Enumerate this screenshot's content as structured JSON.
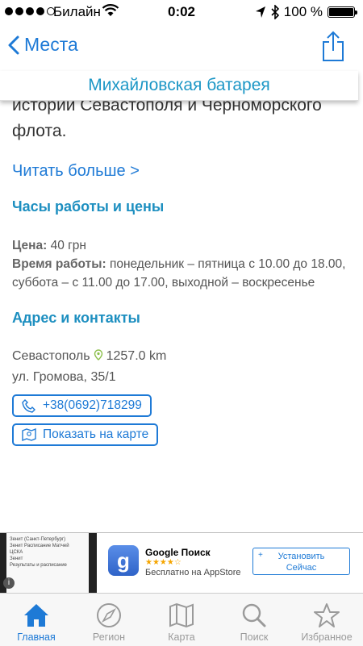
{
  "status_bar": {
    "carrier": "Билайн",
    "time": "0:02",
    "battery_text": "100 %",
    "battery_level": 1.0,
    "signal_bars_filled": 4
  },
  "nav": {
    "back_label": "Места",
    "title": "Михайловская батарея"
  },
  "content": {
    "intro": "истории Севастополя и Черноморского флота.",
    "read_more": "Читать больше >",
    "hours_section": {
      "heading": "Часы работы и цены",
      "price_label": "Цена:",
      "price_value": "40 грн",
      "hours_label": "Время работы:",
      "hours_value": "понедельник – пятница с 10.00 до 18.00, суббота – с 11.00 до 17.00, выходной – воскресенье"
    },
    "address_section": {
      "heading": "Адрес и контакты",
      "city": "Севастополь",
      "distance": "1257.0 km",
      "street": "ул. Громова, 35/1",
      "phone": "+38(0692)718299",
      "map_button": "Показать на карте"
    }
  },
  "ad": {
    "thumb_lines": [
      "Зенит (Санкт-Петербург)",
      "Зенит Расписание Матчей",
      "ЦСКА",
      "Зенит",
      "Результаты и расписание"
    ],
    "app_name": "Google Поиск",
    "stars": "★★★★☆",
    "subtitle": "Бесплатно на AppStore",
    "install_line1": "Установить",
    "install_line2": "Сейчас",
    "plus": "+",
    "icon_letter": "g",
    "info": "i"
  },
  "tabs": [
    {
      "label": "Главная",
      "icon": "home-icon",
      "active": true
    },
    {
      "label": "Регион",
      "icon": "compass-icon",
      "active": false
    },
    {
      "label": "Карта",
      "icon": "map-icon",
      "active": false
    },
    {
      "label": "Поиск",
      "icon": "search-icon",
      "active": false
    },
    {
      "label": "Избранное",
      "icon": "star-icon",
      "active": false
    }
  ],
  "colors": {
    "accent": "#1e7ad6",
    "heading": "#1d8fc0",
    "tab_inactive": "#9a9a9a"
  }
}
